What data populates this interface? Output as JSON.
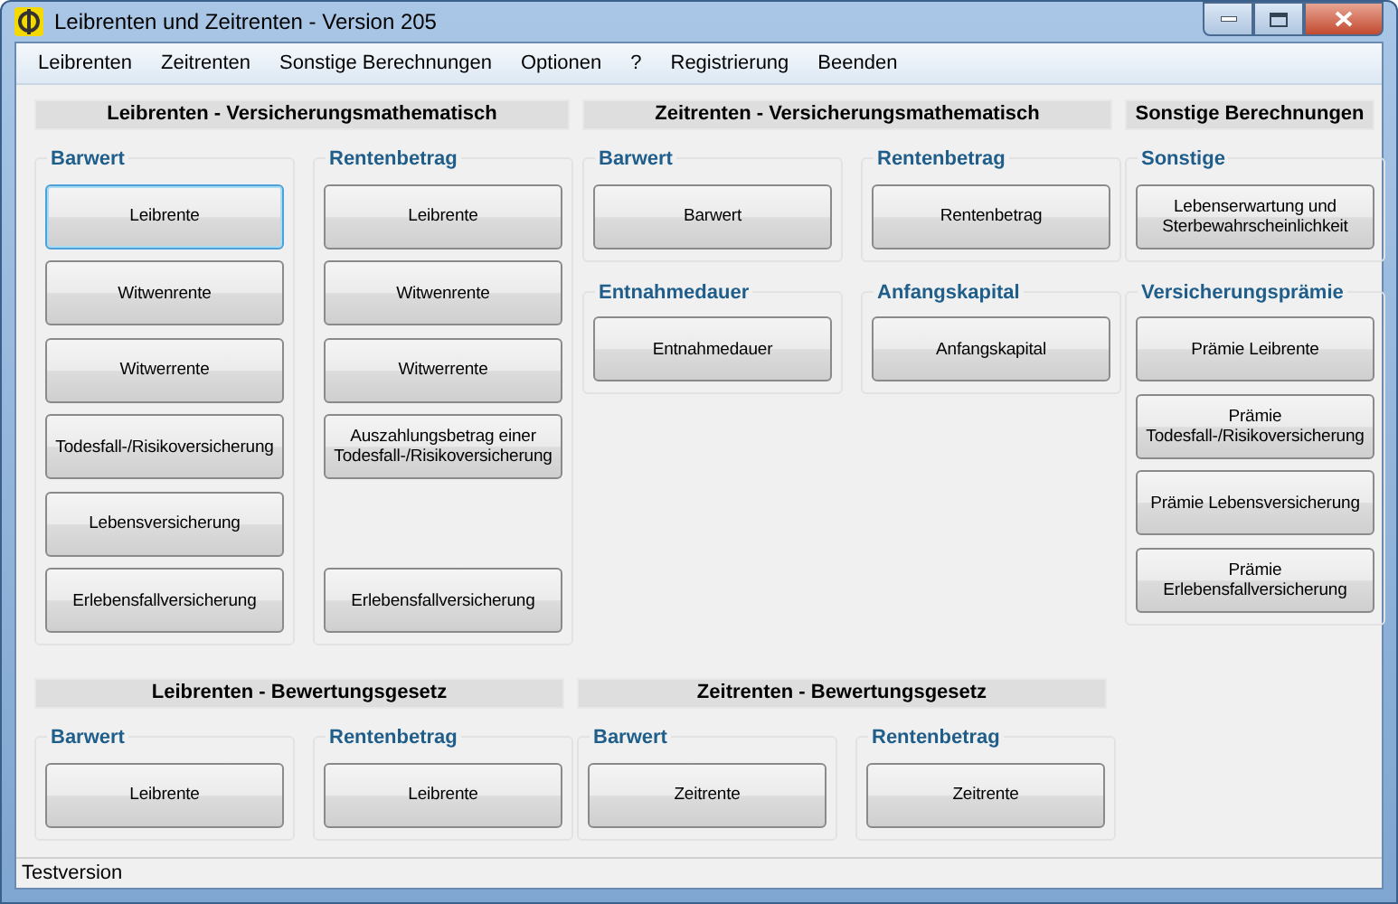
{
  "window": {
    "title": "Leibrenten und Zeitrenten - Version 205"
  },
  "menu": [
    "Leibrenten",
    "Zeitrenten",
    "Sonstige Berechnungen",
    "Optionen",
    "?",
    "Registrierung",
    "Beenden"
  ],
  "rows": [
    {
      "sections": [
        {
          "header": "Leibrenten - Versicherungsmathematisch",
          "groups": [
            {
              "title": "Barwert",
              "buttons": [
                {
                  "kind": "button",
                  "label": "Leibrente",
                  "focused": true
                },
                {
                  "kind": "button",
                  "label": "Witwenrente",
                  "focused": false
                },
                {
                  "kind": "button",
                  "label": "Witwerrente",
                  "focused": false
                },
                {
                  "kind": "button",
                  "label": "Todesfall-/Risikoversicherung",
                  "focused": false
                },
                {
                  "kind": "button",
                  "label": "Lebensversicherung",
                  "focused": false
                },
                {
                  "kind": "button",
                  "label": "Erlebensfallversicherung",
                  "focused": false
                }
              ]
            },
            {
              "title": "Rentenbetrag",
              "buttons": [
                {
                  "kind": "button",
                  "label": "Leibrente",
                  "focused": false
                },
                {
                  "kind": "button",
                  "label": "Witwenrente",
                  "focused": false
                },
                {
                  "kind": "button",
                  "label": "Witwerrente",
                  "focused": false
                },
                {
                  "kind": "button",
                  "label": "Auszahlungsbetrag einer Todesfall-/Risikoversicherung",
                  "focused": false
                },
                {
                  "kind": "gap"
                },
                {
                  "kind": "button",
                  "label": "Erlebensfallversicherung",
                  "focused": false
                }
              ]
            }
          ]
        },
        {
          "header": "Zeitrenten - Versicherungsmathematisch",
          "groups": [
            {
              "title": "Barwert",
              "buttons": [
                {
                  "kind": "button",
                  "label": "Barwert",
                  "focused": false
                }
              ]
            },
            {
              "title": "Rentenbetrag",
              "buttons": [
                {
                  "kind": "button",
                  "label": "Rentenbetrag",
                  "focused": false
                }
              ]
            },
            {
              "title": "Entnahmedauer",
              "buttons": [
                {
                  "kind": "button",
                  "label": "Entnahmedauer",
                  "focused": false
                }
              ]
            },
            {
              "title": "Anfangskapital",
              "buttons": [
                {
                  "kind": "button",
                  "label": "Anfangskapital",
                  "focused": false
                }
              ]
            }
          ]
        },
        {
          "header": "Sonstige Berechnungen",
          "groups": [
            {
              "title": "Sonstige",
              "buttons": [
                {
                  "kind": "button",
                  "label": "Lebenserwartung und Sterbewahrscheinlichkeit",
                  "focused": false
                }
              ]
            },
            {
              "title": "Versicherungsprämie",
              "buttons": [
                {
                  "kind": "button",
                  "label": "Prämie Leibrente",
                  "focused": false
                },
                {
                  "kind": "button",
                  "label": "Prämie Todesfall-/Risikoversicherung",
                  "focused": false
                },
                {
                  "kind": "button",
                  "label": "Prämie Lebensversicherung",
                  "focused": false
                },
                {
                  "kind": "button",
                  "label": "Prämie Erlebensfallversicherung",
                  "focused": false
                }
              ]
            }
          ]
        }
      ]
    },
    {
      "sections": [
        {
          "header": "Leibrenten - Bewertungsgesetz",
          "groups": [
            {
              "title": "Barwert",
              "buttons": [
                {
                  "kind": "button",
                  "label": "Leibrente",
                  "focused": false
                }
              ]
            },
            {
              "title": "Rentenbetrag",
              "buttons": [
                {
                  "kind": "button",
                  "label": "Leibrente",
                  "focused": false
                }
              ]
            }
          ]
        },
        {
          "header": "Zeitrenten - Bewertungsgesetz",
          "groups": [
            {
              "title": "Barwert",
              "buttons": [
                {
                  "kind": "button",
                  "label": "Zeitrente",
                  "focused": false
                }
              ]
            },
            {
              "title": "Rentenbetrag",
              "buttons": [
                {
                  "kind": "button",
                  "label": "Zeitrente",
                  "focused": false
                }
              ]
            }
          ]
        }
      ]
    }
  ],
  "status_bar": "Testversion"
}
